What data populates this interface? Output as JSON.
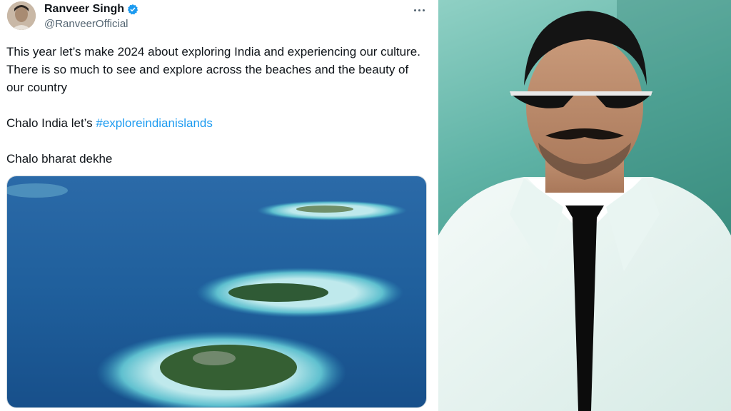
{
  "tweet": {
    "author_name": "Ranveer Singh",
    "author_handle": "@RanveerOfficial",
    "verified_icon": "verified-badge-icon",
    "more_icon": "more-horizontal-icon",
    "line1": "This year let’s make 2024 about exploring India and experiencing our culture. There is so much to see and explore across the beaches and the beauty of our country",
    "line2_prefix": "Chalo India let’s ",
    "hashtag": "#exploreindianislands",
    "line3": "Chalo bharat dekhe",
    "link_color": "#1d9bf0",
    "text_color": "#0f1419",
    "media_subject": "aerial view of tropical islands"
  },
  "photo": {
    "subject": "man in white suit, black tie and sunglasses"
  }
}
